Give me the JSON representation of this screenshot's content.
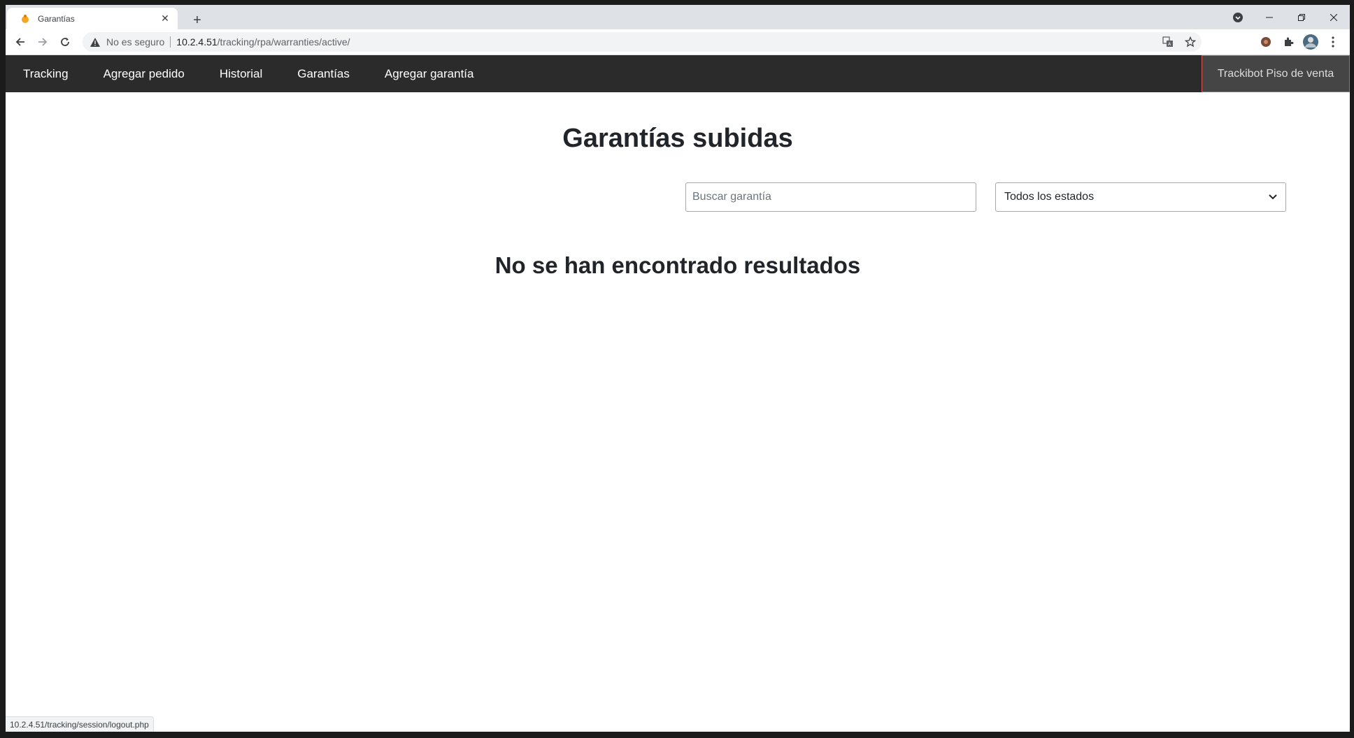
{
  "browser": {
    "tab_title": "Garantías",
    "security_text": "No es seguro",
    "url_host": "10.2.4.51",
    "url_path": "/tracking/rpa/warranties/active/",
    "status_url": "10.2.4.51/tracking/session/logout.php"
  },
  "nav": {
    "items": [
      {
        "label": "Tracking"
      },
      {
        "label": "Agregar pedido"
      },
      {
        "label": "Historial"
      },
      {
        "label": "Garantías"
      },
      {
        "label": "Agregar garantía"
      }
    ],
    "user_label": "Trackibot Piso de venta"
  },
  "main": {
    "title": "Garantías subidas",
    "search_placeholder": "Buscar garantía",
    "state_select": "Todos los estados",
    "empty_message": "No se han encontrado resultados"
  },
  "colors": {
    "navbar_bg": "#2b2b2b",
    "user_btn_bg": "#454545",
    "user_btn_border": "#d9534f",
    "heading": "#212529"
  }
}
